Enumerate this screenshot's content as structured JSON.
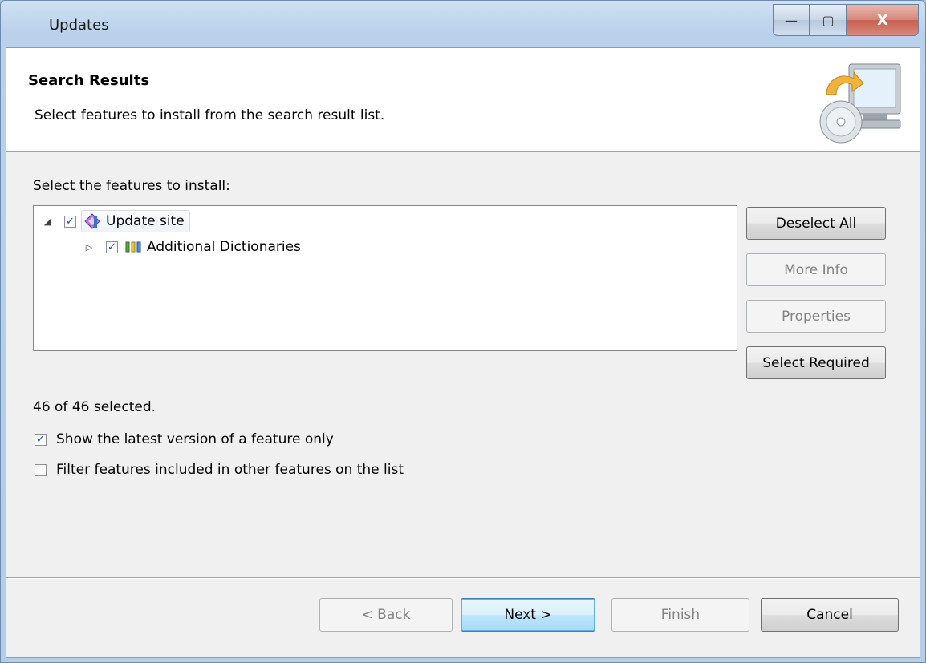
{
  "window": {
    "title": "Updates",
    "controls": {
      "minimize": "—",
      "maximize": "▢",
      "close": "X"
    }
  },
  "header": {
    "title": "Search Results",
    "description": "Select features to install from the search result list."
  },
  "features_label": "Select the features to install:",
  "tree": {
    "items": [
      {
        "label": "Update site",
        "checked": true,
        "expanded": true,
        "icon": "update-site-icon"
      },
      {
        "label": "Additional Dictionaries",
        "checked": true,
        "expanded": false,
        "icon": "feature-icon"
      }
    ]
  },
  "side_buttons": {
    "deselect_all": "Deselect All",
    "more_info": "More Info",
    "properties": "Properties",
    "select_required": "Select Required"
  },
  "status": "46 of 46 selected.",
  "options": {
    "latest_version": {
      "label": "Show the latest version of a feature only",
      "checked": true
    },
    "filter_included": {
      "label": "Filter features included in other features on the list",
      "checked": false
    }
  },
  "footer": {
    "back": "< Back",
    "next": "Next >",
    "finish": "Finish",
    "cancel": "Cancel"
  }
}
